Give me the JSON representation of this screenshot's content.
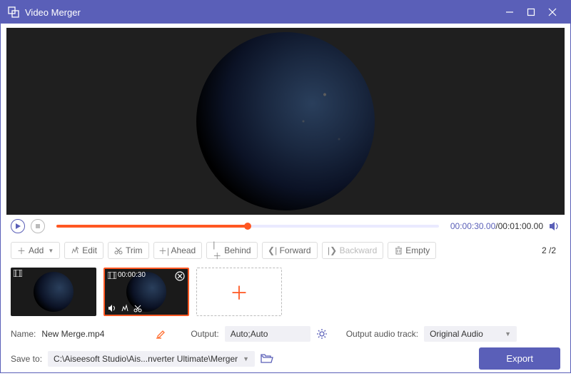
{
  "titlebar": {
    "title": "Video Merger"
  },
  "playback": {
    "current_time": "00:00:30.00",
    "total_time": "00:01:00.00",
    "progress_percent": 50
  },
  "toolbar": {
    "add": "Add",
    "edit": "Edit",
    "trim": "Trim",
    "ahead": "Ahead",
    "behind": "Behind",
    "forward": "Forward",
    "backward": "Backward",
    "empty": "Empty",
    "counter_current": "2",
    "counter_total": "2"
  },
  "thumbnails": {
    "selected_timestamp": "00:00:30"
  },
  "output": {
    "name_label": "Name:",
    "name_value": "New Merge.mp4",
    "output_label": "Output:",
    "output_value": "Auto;Auto",
    "audio_label": "Output audio track:",
    "audio_value": "Original Audio",
    "saveto_label": "Save to:",
    "saveto_value": "C:\\Aiseesoft Studio\\Ais...nverter Ultimate\\Merger",
    "export_label": "Export"
  }
}
